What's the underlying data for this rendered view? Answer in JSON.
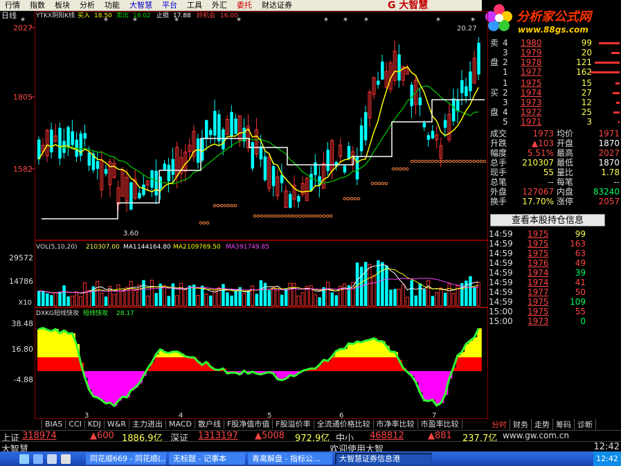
{
  "menu": [
    "行情",
    "指数",
    "板块",
    "分析",
    "功能",
    "大智慧",
    "平台",
    "工具",
    "外汇",
    "委托",
    "财达证券"
  ],
  "brand": "G 大智慧",
  "logo": {
    "text": "分析家公式网",
    "url": "www.88gs.com"
  },
  "period_label": "日线",
  "main_header": {
    "name": "YTKX阴阳K线",
    "buy_label": "买入",
    "buy": "18.50",
    "sell_label": "卖出",
    "sell": "18.02",
    "stop_label": "止损",
    "stop": "17.88",
    "good_label": "好机会",
    "good": "16.00"
  },
  "main_axis": [
    "2027",
    "1805",
    "1582"
  ],
  "main_annotations": {
    "high": "20.27",
    "low": "3.60"
  },
  "vol_header": {
    "name": "VOL(5,10,20)",
    "v": "210307.00",
    "ma1_label": "MA1",
    "ma1": "144164.80",
    "ma2_label": "MA2",
    "ma2": "109769.50",
    "ma3_label": "MA3",
    "ma3": "91749.85"
  },
  "vol_axis": [
    "29572",
    "14786",
    "X10"
  ],
  "ind_header": {
    "name": "DXKG短线快攻",
    "line_label": "短线快攻",
    "value": "28.17"
  },
  "ind_axis": [
    "38.48",
    "16.80",
    "-4.88"
  ],
  "x_labels": [
    "3",
    "4",
    "5",
    "6",
    "7"
  ],
  "orderbook": {
    "sell": [
      {
        "side": "卖",
        "idx": "4",
        "price": "1980",
        "vol": "99",
        "bar": 30
      },
      {
        "side": "",
        "idx": "3",
        "price": "1979",
        "vol": "20",
        "bar": 12
      },
      {
        "side": "盘",
        "idx": "2",
        "price": "1978",
        "vol": "121",
        "bar": 36
      },
      {
        "side": "",
        "idx": "1",
        "price": "1977",
        "vol": "162",
        "bar": 42
      }
    ],
    "buy": [
      {
        "side": "",
        "idx": "1",
        "price": "1975",
        "vol": "15",
        "bar": 6
      },
      {
        "side": "买",
        "idx": "2",
        "price": "1974",
        "vol": "27",
        "bar": 10
      },
      {
        "side": "",
        "idx": "3",
        "price": "1973",
        "vol": "12",
        "bar": 5
      },
      {
        "side": "盘",
        "idx": "4",
        "price": "1972",
        "vol": "25",
        "bar": 9
      },
      {
        "side": "",
        "idx": "5",
        "price": "1971",
        "vol": "3",
        "bar": 2
      }
    ]
  },
  "stats": [
    {
      "l1": "成交",
      "v1": "1973",
      "c1": "#ff4444",
      "l2": "均价",
      "v2": "1971",
      "c2": "#ff4444"
    },
    {
      "l1": "升跌",
      "v1": "▲103",
      "c1": "#ff4444",
      "l2": "开盘",
      "v2": "1870",
      "c2": "#ffffff"
    },
    {
      "l1": "幅度",
      "v1": "5.51%",
      "c1": "#ff4444",
      "l2": "最高",
      "v2": "2027",
      "c2": "#ff4444"
    },
    {
      "l1": "总手",
      "v1": "210307",
      "c1": "#ffff55",
      "l2": "最低",
      "v2": "1870",
      "c2": "#ffffff"
    },
    {
      "l1": "现手",
      "v1": "55",
      "c1": "#ffff55",
      "l2": "量比",
      "v2": "1.78",
      "c2": "#ffff55"
    },
    {
      "l1": "总笔",
      "v1": "--",
      "c1": "#ddd",
      "l2": "每笔",
      "v2": "--",
      "c2": "#ddd"
    },
    {
      "l1": "外盘",
      "v1": "127067",
      "c1": "#ff4444",
      "l2": "内盘",
      "v2": "83240",
      "c2": "#00ff66"
    },
    {
      "l1": "换手",
      "v1": "17.70%",
      "c1": "#ffff55",
      "l2": "涨停",
      "v2": "2057",
      "c2": "#ff4444"
    }
  ],
  "hold_button": "查看本股持仓信息",
  "ticks": [
    {
      "t": "14:59",
      "p": "1975",
      "v": "99",
      "c": "#ffff55"
    },
    {
      "t": "14:59",
      "p": "1975",
      "v": "163",
      "c": "#ff4444"
    },
    {
      "t": "14:59",
      "p": "1975",
      "v": "63",
      "c": "#ff4444"
    },
    {
      "t": "14:59",
      "p": "1976",
      "v": "49",
      "c": "#ff4444"
    },
    {
      "t": "14:59",
      "p": "1974",
      "v": "39",
      "c": "#00ff66"
    },
    {
      "t": "14:59",
      "p": "1974",
      "v": "41",
      "c": "#ff4444"
    },
    {
      "t": "14:59",
      "p": "1977",
      "v": "50",
      "c": "#ff4444"
    },
    {
      "t": "14:59",
      "p": "1975",
      "v": "109",
      "c": "#00ff66"
    },
    {
      "t": "15:00",
      "p": "1975",
      "v": "55",
      "c": "#ff4444"
    },
    {
      "t": "15:00",
      "p": "1973",
      "v": "0",
      "c": "#00ff66"
    }
  ],
  "indicator_tabs": [
    "BIAS",
    "CCI",
    "KDJ",
    "W&R",
    "主力进出",
    "MACD",
    "散户线",
    "F股净值市值",
    "F股溢价率",
    "全流通价格比较",
    "市净率比较",
    "市盈率比较"
  ],
  "right_tabs": [
    "分时",
    "财务",
    "走势",
    "筹码",
    "诊断"
  ],
  "status1": {
    "sh": "上证",
    "sh_val": "318974",
    "sh_chg": "▲600",
    "sh_amt": "1886.9亿",
    "sz": "深证",
    "sz_val": "1313197",
    "sz_chg": "▲5008",
    "sz_amt": "972.9亿",
    "zx": "中小",
    "zx_val": "468812",
    "zx_chg": "▲881",
    "zx_amt": "237.7亿",
    "site": "www.gw.com.cn"
  },
  "status2": {
    "left": "大智慧",
    "center": "欢迎使用大智",
    "time": "12:42"
  },
  "taskbar": [
    "同花顺669 - 同花顺(...",
    "无标题 - 记事本",
    "青离解盘 - 指标公...",
    "大智慧证券信息港"
  ],
  "clock": "12:42",
  "colors": {
    "up": "#ff3333",
    "down": "#00ffff",
    "ma_yellow": "#ffff00",
    "ma_green": "#00aa00",
    "step_white": "#ffffff",
    "dot_orange": "#ff8844",
    "ind_yellow": "#ffff00",
    "ind_red": "#ff0000",
    "ind_magenta": "#ff00ff",
    "ind_green": "#33ff33"
  }
}
